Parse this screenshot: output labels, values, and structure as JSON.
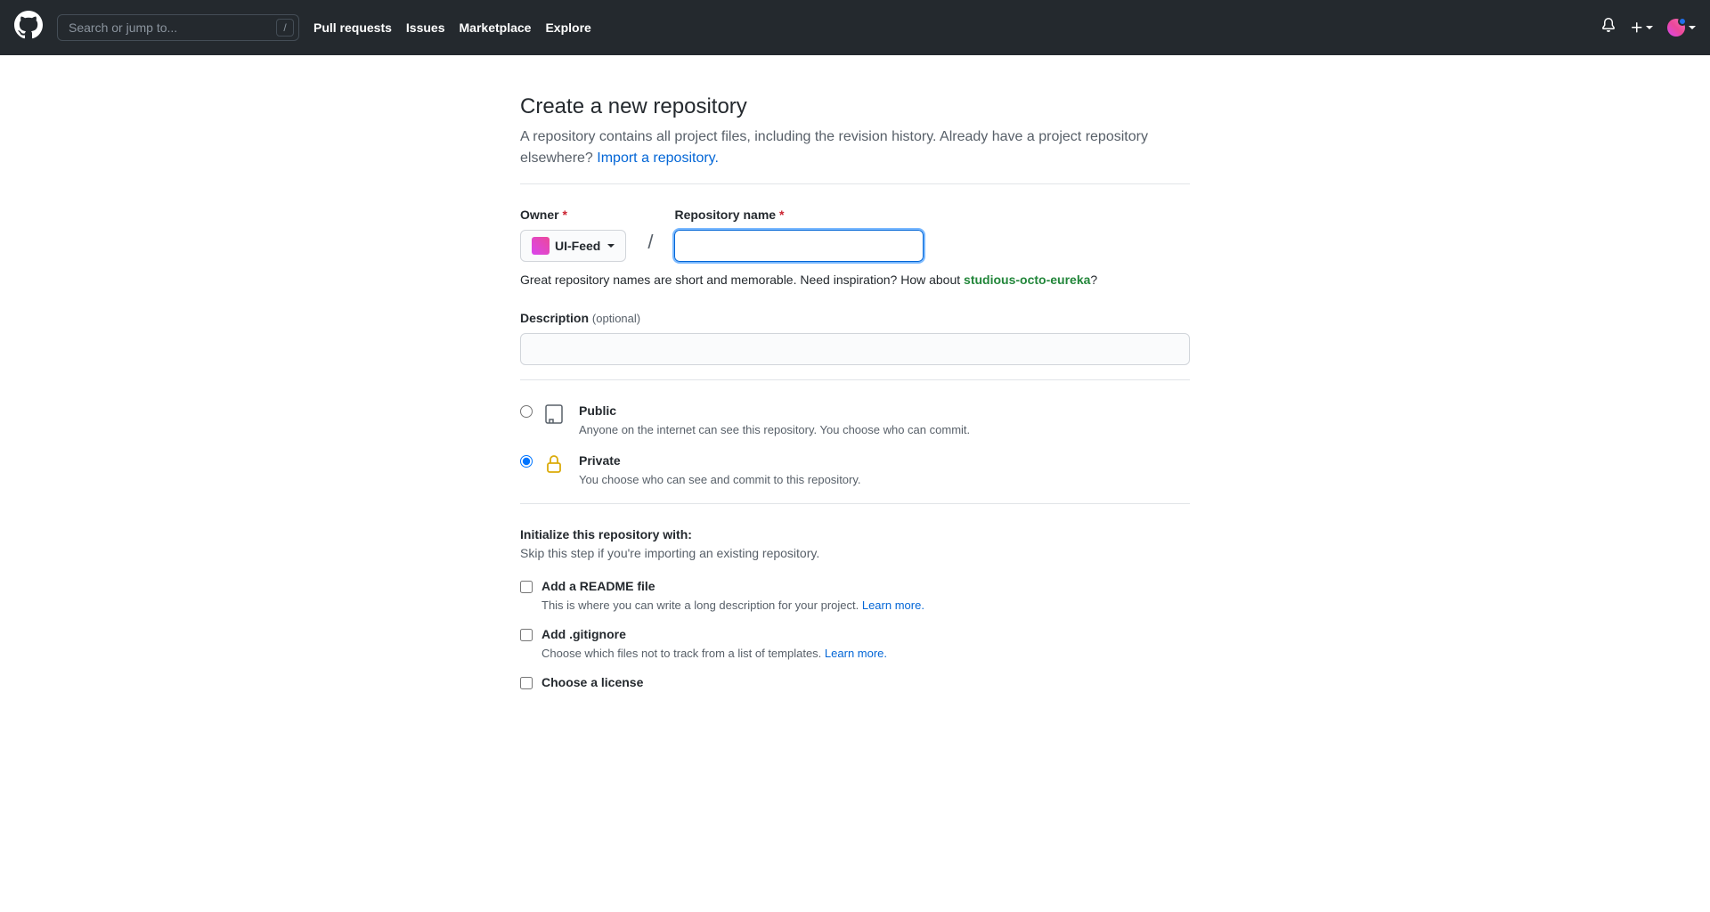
{
  "header": {
    "search_placeholder": "Search or jump to...",
    "nav": [
      "Pull requests",
      "Issues",
      "Marketplace",
      "Explore"
    ]
  },
  "page": {
    "title": "Create a new repository",
    "subtitle_1": "A repository contains all project files, including the revision history. Already have a project repository elsewhere? ",
    "import_link": "Import a repository."
  },
  "form": {
    "owner_label": "Owner",
    "owner_value": "UI-Feed",
    "repo_name_label": "Repository name",
    "repo_name_value": "",
    "hint_prefix": "Great repository names are short and memorable. Need inspiration? How about ",
    "hint_suggestion": "studious-octo-eureka",
    "hint_suffix": "?",
    "description_label": "Description",
    "description_optional": "(optional)",
    "description_value": ""
  },
  "visibility": {
    "public_title": "Public",
    "public_desc": "Anyone on the internet can see this repository. You choose who can commit.",
    "private_title": "Private",
    "private_desc": "You choose who can see and commit to this repository."
  },
  "init": {
    "title": "Initialize this repository with:",
    "subtitle": "Skip this step if you're importing an existing repository.",
    "readme_title": "Add a README file",
    "readme_desc": "This is where you can write a long description for your project. ",
    "readme_learn": "Learn more.",
    "gitignore_title": "Add .gitignore",
    "gitignore_desc": "Choose which files not to track from a list of templates. ",
    "gitignore_learn": "Learn more.",
    "license_title": "Choose a license"
  }
}
